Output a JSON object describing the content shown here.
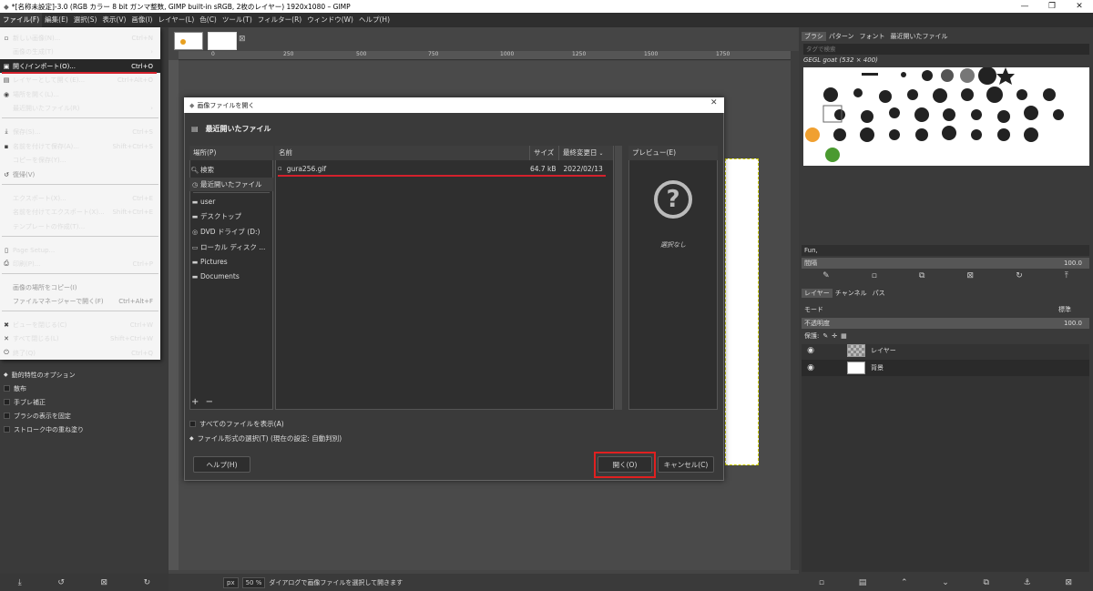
{
  "window": {
    "title": "*[名称未設定]-3.0 (RGB カラー 8 bit ガンマ整数, GIMP built-in sRGB, 2枚のレイヤー) 1920x1080 – GIMP",
    "controls": [
      "—",
      "❐",
      "✕"
    ]
  },
  "menubar": [
    "ファイル(F)",
    "編集(E)",
    "選択(S)",
    "表示(V)",
    "画像(I)",
    "レイヤー(L)",
    "色(C)",
    "ツール(T)",
    "フィルター(R)",
    "ウィンドウ(W)",
    "ヘルプ(H)"
  ],
  "file_menu": {
    "items": [
      {
        "icon": "new-image-icon",
        "glyph": "▫",
        "label": "新しい画像(N)...",
        "shortcut": "Ctrl+N",
        "disabled": false
      },
      {
        "icon": "",
        "glyph": "",
        "label": "画像の生成(T)",
        "shortcut": "›",
        "disabled": false
      },
      {
        "icon": "open-icon",
        "glyph": "▣",
        "label": "開く/インポート(O)...",
        "shortcut": "Ctrl+O",
        "disabled": false,
        "highlighted": true
      },
      {
        "icon": "open-as-layers-icon",
        "glyph": "▤",
        "label": "レイヤーとして開く(E)...",
        "shortcut": "Ctrl+Alt+O",
        "disabled": false
      },
      {
        "icon": "open-location-icon",
        "glyph": "◉",
        "label": "場所を開く(L)...",
        "shortcut": "",
        "disabled": false
      },
      {
        "icon": "",
        "glyph": "",
        "label": "最近開いたファイル(R)",
        "shortcut": "›",
        "disabled": false
      },
      {
        "icon": "save-icon",
        "glyph": "⤓",
        "label": "保存(S)...",
        "shortcut": "Ctrl+S",
        "disabled": false
      },
      {
        "icon": "save-as-icon",
        "glyph": "▪",
        "label": "名前を付けて保存(A)...",
        "shortcut": "Shift+Ctrl+S",
        "disabled": false
      },
      {
        "icon": "",
        "glyph": "",
        "label": "コピーを保存(Y)...",
        "shortcut": "",
        "disabled": false
      },
      {
        "icon": "revert-icon",
        "glyph": "↺",
        "label": "復帰(V)",
        "shortcut": "",
        "disabled": true
      },
      {
        "icon": "",
        "glyph": "",
        "label": "エクスポート(X)...",
        "shortcut": "Ctrl+E",
        "disabled": false
      },
      {
        "icon": "",
        "glyph": "",
        "label": "名前を付けてエクスポート(X)...",
        "shortcut": "Shift+Ctrl+E",
        "disabled": false
      },
      {
        "icon": "",
        "glyph": "",
        "label": "テンプレートの作成(T)...",
        "shortcut": "",
        "disabled": false
      },
      {
        "icon": "page-setup-icon",
        "glyph": "▯",
        "label": "Page Setup...",
        "shortcut": "",
        "disabled": false
      },
      {
        "icon": "print-icon",
        "glyph": "⎙",
        "label": "印刷(P)...",
        "shortcut": "Ctrl+P",
        "disabled": false
      },
      {
        "icon": "",
        "glyph": "",
        "label": "画像の場所をコピー(I)",
        "shortcut": "",
        "disabled": true
      },
      {
        "icon": "",
        "glyph": "",
        "label": "ファイルマネージャーで開く(F)",
        "shortcut": "Ctrl+Alt+F",
        "disabled": true
      },
      {
        "icon": "close-view-icon",
        "glyph": "✖",
        "label": "ビューを閉じる(C)",
        "shortcut": "Ctrl+W",
        "disabled": false
      },
      {
        "icon": "close-all-icon",
        "glyph": "✕",
        "label": "すべて閉じる(L)",
        "shortcut": "Shift+Ctrl+W",
        "disabled": false
      },
      {
        "icon": "quit-icon",
        "glyph": "⏻",
        "label": "終了(Q)",
        "shortcut": "Ctrl+Q",
        "disabled": false
      }
    ]
  },
  "tool_options": [
    {
      "label": "動的特性のオプション",
      "expander": true
    },
    {
      "label": "散布",
      "expander": false
    },
    {
      "label": "手ブレ補正",
      "expander": false
    },
    {
      "label": "ブラシの表示を固定",
      "expander": false
    },
    {
      "label": "ストローク中の重ね塗り",
      "expander": false
    }
  ],
  "left_bottom_buttons": [
    "⤓",
    "↺",
    "⊠",
    "↻"
  ],
  "canvas": {
    "ruler_ticks": [
      "0",
      "250",
      "500",
      "750",
      "1000",
      "1250",
      "1500",
      "1750"
    ],
    "status": {
      "unit": "px",
      "zoom": "50 %",
      "message": "ダイアログで画像ファイルを選択して開きます"
    }
  },
  "right_panel": {
    "top_tabs": [
      "ブラシ",
      "パターン",
      "フォント",
      "最近開いたファイル"
    ],
    "brush_filter_placeholder": "タグで検索",
    "brush_info": "GEGL goat (532 × 400)",
    "preset_name": "Fun,",
    "spacing_label": "間隔",
    "spacing_value": "100.0",
    "layer_tabs": [
      "レイヤー",
      "チャンネル",
      "パス"
    ],
    "mode_label": "モード",
    "mode_value": "標準",
    "opacity_label": "不透明度",
    "opacity_value": "100.0",
    "lock_label": "保護:",
    "layers": [
      {
        "name": "レイヤー",
        "selected": false
      },
      {
        "name": "背景",
        "selected": true
      }
    ]
  },
  "dialog": {
    "title": "画像ファイルを開く",
    "header": "最近開いたファイル",
    "places_header": "場所(P)",
    "places": [
      {
        "icon": "search-icon",
        "glyph": "🔍︎",
        "label": "検索"
      },
      {
        "icon": "recent-icon",
        "glyph": "◷",
        "label": "最近開いたファイル",
        "selected": true
      },
      {
        "icon": "folder-icon",
        "glyph": "▬",
        "label": "user"
      },
      {
        "icon": "folder-icon",
        "glyph": "▬",
        "label": "デスクトップ"
      },
      {
        "icon": "disc-icon",
        "glyph": "◎",
        "label": "DVD ドライブ (D:)"
      },
      {
        "icon": "drive-icon",
        "glyph": "▭",
        "label": "ローカル ディスク ..."
      },
      {
        "icon": "folder-icon",
        "glyph": "▬",
        "label": "Pictures"
      },
      {
        "icon": "folder-icon",
        "glyph": "▬",
        "label": "Documents"
      }
    ],
    "columns": {
      "name": "名前",
      "size": "サイズ",
      "modified": "最終変更日"
    },
    "files": [
      {
        "name": "gura256.gif",
        "size": "64.7 kB",
        "modified": "2022/02/13"
      }
    ],
    "preview_header": "プレビュー(E)",
    "preview_empty": "選択なし",
    "show_all_label": "すべてのファイルを表示(A)",
    "file_type_label": "ファイル形式の選択(T) (現在の設定: 自動判別)",
    "help_button": "ヘルプ(H)",
    "open_button": "開く(O)",
    "cancel_button": "キャンセル(C)"
  }
}
